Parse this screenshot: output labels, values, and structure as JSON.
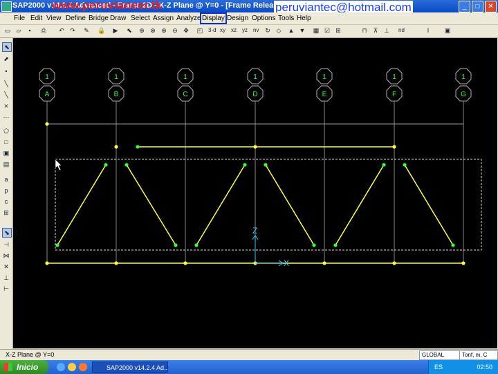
{
  "window": {
    "title": "SAP2000 v14.2.4 Advanced - Frame 2D - X-Z Plane @ Y=0 - [Frame Releases]",
    "watermark": "www.peruvianeer.tk",
    "email": "peruviantec@hotmail.com"
  },
  "menu": [
    "File",
    "Edit",
    "View",
    "Define",
    "Bridge",
    "Draw",
    "Select",
    "Assign",
    "Analyze",
    "Display",
    "Design",
    "Options",
    "Tools",
    "Help"
  ],
  "highlighted_menu": "Display",
  "toolbar": {
    "views": [
      "3-d",
      "xy",
      "xz",
      "yz",
      "nv"
    ],
    "nd_label": "nd"
  },
  "grid": {
    "labels_top": [
      "1",
      "1",
      "1",
      "1",
      "1",
      "1",
      "1"
    ],
    "labels_bottom": [
      "A",
      "B",
      "C",
      "D",
      "E",
      "F",
      "G"
    ]
  },
  "axes": {
    "z": "Z",
    "x": "X"
  },
  "status": {
    "text": "X-Z Plane @ Y=0",
    "coord": "GLOBAL",
    "units": "Tonf, m, C"
  },
  "taskbar": {
    "start": "Inicio",
    "task": "SAP2000 v14.2.4 Ad...",
    "lang": "ES",
    "clock": "02:50"
  },
  "colors": {
    "frame": "#ffff40",
    "node": "#30ff30",
    "grid": "#b0b0b0",
    "grid_label": "#30ff30",
    "axis": "#30d0ff",
    "canvas": "#000000"
  }
}
